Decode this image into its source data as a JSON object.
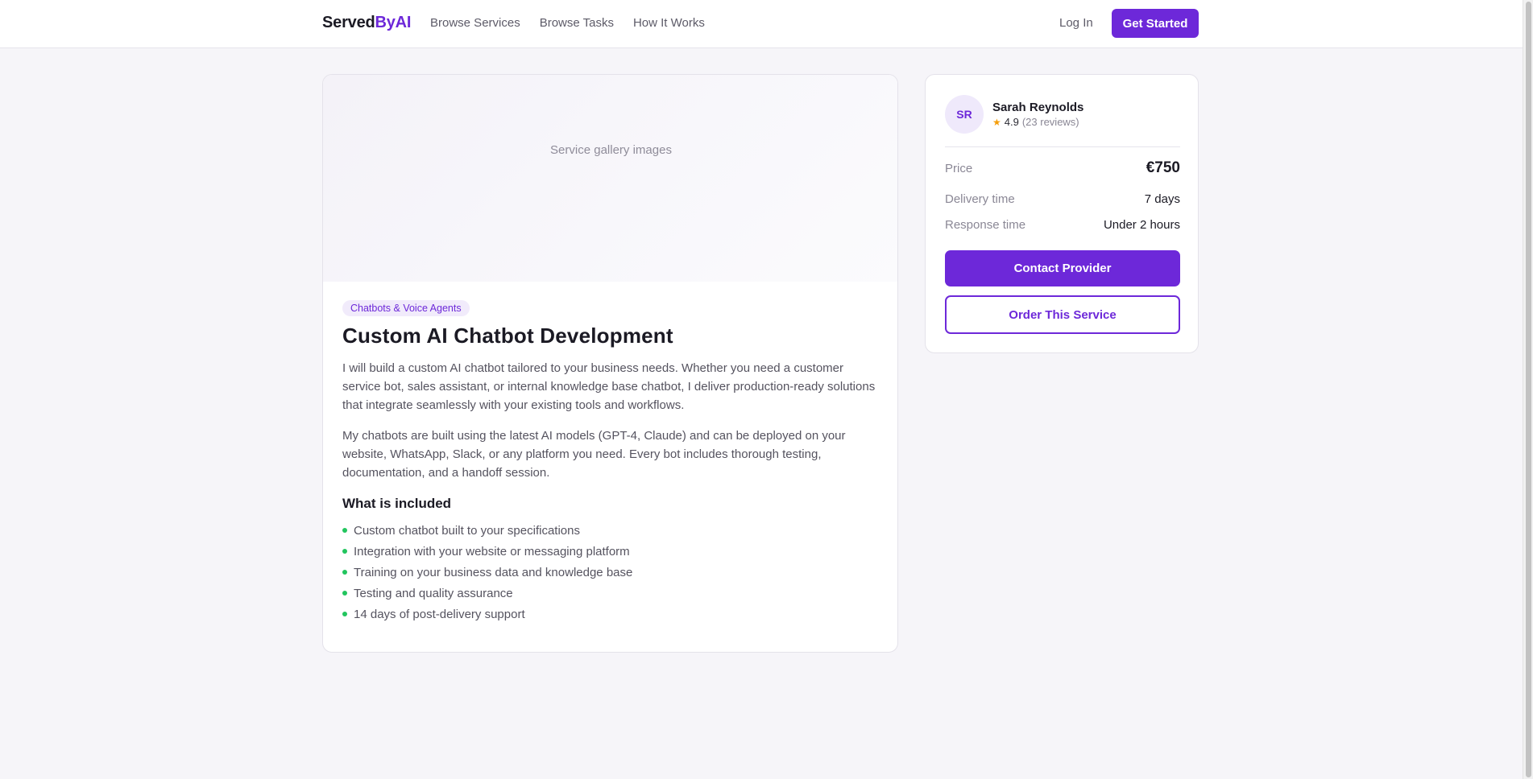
{
  "header": {
    "logo_main": "Served",
    "logo_accent": "ByAI",
    "nav": [
      "Browse Services",
      "Browse Tasks",
      "How It Works"
    ],
    "login_label": "Log In",
    "cta_label": "Get Started"
  },
  "colors": {
    "accent": "#6d28d9",
    "bullet": "#22c55e",
    "star": "#f59e0b"
  },
  "service": {
    "gallery_placeholder": "Service gallery images",
    "category": "Chatbots & Voice Agents",
    "title": "Custom AI Chatbot Development",
    "description": [
      "I will build a custom AI chatbot tailored to your business needs. Whether you need a customer service bot, sales assistant, or internal knowledge base chatbot, I deliver production-ready solutions that integrate seamlessly with your existing tools and workflows.",
      "My chatbots are built using the latest AI models (GPT-4, Claude) and can be deployed on your website, WhatsApp, Slack, or any platform you need. Every bot includes thorough testing, documentation, and a handoff session."
    ],
    "included_heading": "What is included",
    "included": [
      "Custom chatbot built to your specifications",
      "Integration with your website or messaging platform",
      "Training on your business data and knowledge base",
      "Testing and quality assurance",
      "14 days of post-delivery support"
    ]
  },
  "provider": {
    "initials": "SR",
    "name": "Sarah Reynolds",
    "star_icon": "star-icon",
    "rating": "4.9",
    "reviews": "(23 reviews)"
  },
  "pricing": {
    "price_label": "Price",
    "price_value": "€750",
    "delivery_label": "Delivery time",
    "delivery_value": "7 days",
    "response_label": "Response time",
    "response_value": "Under 2 hours",
    "contact_label": "Contact Provider",
    "order_label": "Order This Service"
  }
}
